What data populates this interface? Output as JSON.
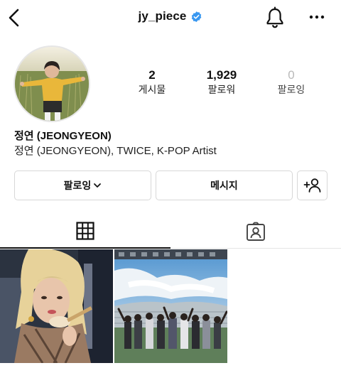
{
  "header": {
    "username": "jy_piece",
    "verified": true,
    "back_icon": "chevron-left-icon",
    "bell_icon": "bell-icon",
    "more_icon": "more-horizontal-icon"
  },
  "profile": {
    "stats": [
      {
        "value": "2",
        "label": "게시물"
      },
      {
        "value": "1,929",
        "label": "팔로워"
      },
      {
        "value": "0",
        "label": "팔로잉"
      }
    ],
    "name": "정연 (JEONGYEON)",
    "bio": "정연 (JEONGYEON), TWICE, K-POP Artist"
  },
  "actions": {
    "following_label": "팔로잉",
    "message_label": "메시지",
    "add_icon": "add-person-icon"
  },
  "tabs": [
    {
      "icon": "grid-icon",
      "active": true
    },
    {
      "icon": "tagged-person-icon",
      "active": false
    }
  ],
  "colors": {
    "verified_blue": "#3897f0",
    "border": "#d7d7d7",
    "muted": "#b9b9b9"
  }
}
